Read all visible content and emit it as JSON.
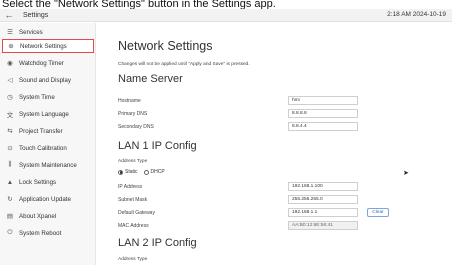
{
  "caption": "Select the \"Network Settings\" button in the Settings app.",
  "topbar": {
    "back_icon": "arrow-left-icon",
    "title": "Settings",
    "datetime": "2:18 AM 2024-10-19"
  },
  "sidebar": {
    "items": [
      {
        "label": "Services",
        "icon": "services-icon",
        "glyph": "☰"
      },
      {
        "label": "Network Settings",
        "icon": "network-icon",
        "glyph": "⊕",
        "active": true
      },
      {
        "label": "Watchdog Timer",
        "icon": "watchdog-icon",
        "glyph": "◉"
      },
      {
        "label": "Sound and Display",
        "icon": "speaker-icon",
        "glyph": "◁"
      },
      {
        "label": "System Time",
        "icon": "clock-icon",
        "glyph": "◷"
      },
      {
        "label": "System Language",
        "icon": "language-icon",
        "glyph": "文"
      },
      {
        "label": "Project Transfer",
        "icon": "transfer-icon",
        "glyph": "⇆"
      },
      {
        "label": "Touch Calibration",
        "icon": "target-icon",
        "glyph": "⊙"
      },
      {
        "label": "System Maintenance",
        "icon": "maintenance-icon",
        "glyph": "⫼"
      },
      {
        "label": "Lock Settings",
        "icon": "lock-icon",
        "glyph": "▲"
      },
      {
        "label": "Application Update",
        "icon": "refresh-icon",
        "glyph": "↻"
      },
      {
        "label": "About Xpanel",
        "icon": "about-icon",
        "glyph": "▤"
      },
      {
        "label": "System Reboot",
        "icon": "power-icon",
        "glyph": "⏻"
      }
    ]
  },
  "main": {
    "title": "Network Settings",
    "notice": "Changes will not be applied until \"Apply and Save\" is pressed.",
    "name_server": {
      "title": "Name Server",
      "hostname_label": "Hostname",
      "hostname_value": "hmi",
      "primary_dns_label": "Primary DNS",
      "primary_dns_value": "8.8.8.8",
      "secondary_dns_label": "Secondary DNS",
      "secondary_dns_value": "8.8.4.4"
    },
    "lan1": {
      "title": "LAN 1 IP Config",
      "address_type_label": "Address Type",
      "static_label": "Static",
      "dhcp_label": "DHCP",
      "ip_label": "IP Address",
      "ip_value": "192.168.1.100",
      "mask_label": "Subnet Mask",
      "mask_value": "255.255.255.0",
      "gateway_label": "Default Gateway",
      "gateway_value": "192.168.1.1",
      "clear_label": "Clear",
      "mac_label": "MAC Address",
      "mac_value": "AA:B0:12:6E:56:41"
    },
    "lan2": {
      "title": "LAN 2 IP Config",
      "address_type_label": "Address Type"
    }
  }
}
